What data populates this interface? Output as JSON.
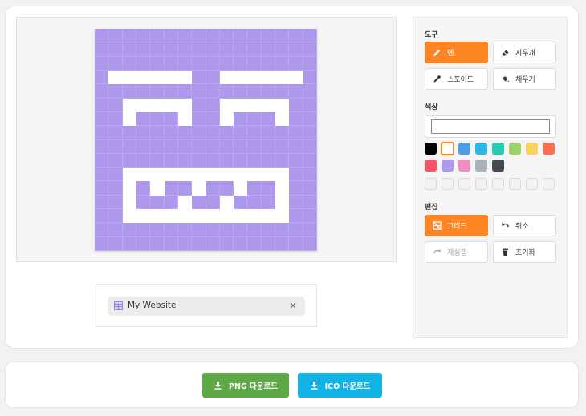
{
  "canvas": {
    "fill_color": "#ad98ec",
    "white_color": "#ffffff",
    "rows": [
      "................",
      "................",
      "................",
      ".######..######.",
      "................",
      "..#####..#####..",
      "..#...#..#...#..",
      "................",
      "................",
      "................",
      "..############..",
      "..#.#..#..#..#..",
      "..#...#..#...#..",
      "..############..",
      "................",
      "................"
    ]
  },
  "preview": {
    "tab_title": "My Website",
    "close_symbol": "×",
    "icon": "window-favicon"
  },
  "panel": {
    "tools_title": "도구",
    "tools": {
      "pen": "펜",
      "eraser": "지우개",
      "eyedropper": "스포이드",
      "fill": "채우기"
    },
    "color_title": "색상",
    "current_color": "#ffffff",
    "palette": [
      "#000000",
      "#ffffff",
      "#4d9de6",
      "#2bb8e6",
      "#26cdb0",
      "#9ed36a",
      "#fcd35a",
      "#fa6e52",
      "#f85468",
      "#ad98ec",
      "#f18dc2",
      "#aab1bb",
      "#434a54"
    ],
    "selected_index": 1,
    "empty_slots": 8,
    "edit_title": "편집",
    "edit": {
      "grid": "그리드",
      "undo": "취소",
      "redo": "재실행",
      "reset": "초기화"
    }
  },
  "downloads": {
    "png_label": "PNG 다운로드",
    "png_color": "#5ea848",
    "ico_label": "ICO 다운로드",
    "ico_color": "#13b2e5"
  }
}
